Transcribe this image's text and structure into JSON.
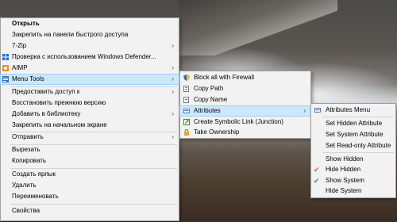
{
  "main_menu": {
    "items": [
      {
        "label": "Открыть"
      },
      {
        "label": "Закрепить на панели быстрого доступа"
      },
      {
        "label": "7-Zip"
      },
      {
        "label": "Проверка с использованием Windows Defender..."
      },
      {
        "label": "AIMP"
      },
      {
        "label": "Menu Tools"
      },
      {
        "label": "Предоставить доступ к"
      },
      {
        "label": "Восстановить прежнюю версию"
      },
      {
        "label": "Добавить в библиотеку"
      },
      {
        "label": "Закрепить на начальном экране"
      },
      {
        "label": "Отправить"
      },
      {
        "label": "Вырезать"
      },
      {
        "label": "Копировать"
      },
      {
        "label": "Создать ярлык"
      },
      {
        "label": "Удалить"
      },
      {
        "label": "Переименовать"
      },
      {
        "label": "Свойства"
      }
    ]
  },
  "menu_tools": {
    "items": [
      {
        "label": "Block all with Firewall"
      },
      {
        "label": "Copy Path"
      },
      {
        "label": "Copy Name"
      },
      {
        "label": "Attributes"
      },
      {
        "label": "Create Symbolic Link (Junction)"
      },
      {
        "label": "Take Ownership"
      }
    ]
  },
  "attributes": {
    "items": [
      {
        "label": "Attributes Menu"
      },
      {
        "label": "Set Hidden Attribute"
      },
      {
        "label": "Set System Attribute"
      },
      {
        "label": "Set Read-only Attribute"
      },
      {
        "label": "Show Hidden"
      },
      {
        "label": "Hide Hidden"
      },
      {
        "label": "Show System"
      },
      {
        "label": "Hide System"
      }
    ]
  },
  "arrow_glyph": "›",
  "colors": {
    "highlight": "#cce8ff",
    "menu_bg": "#f2f2f2",
    "check_red": "#d9534f",
    "check_green": "#2e9e3e"
  }
}
